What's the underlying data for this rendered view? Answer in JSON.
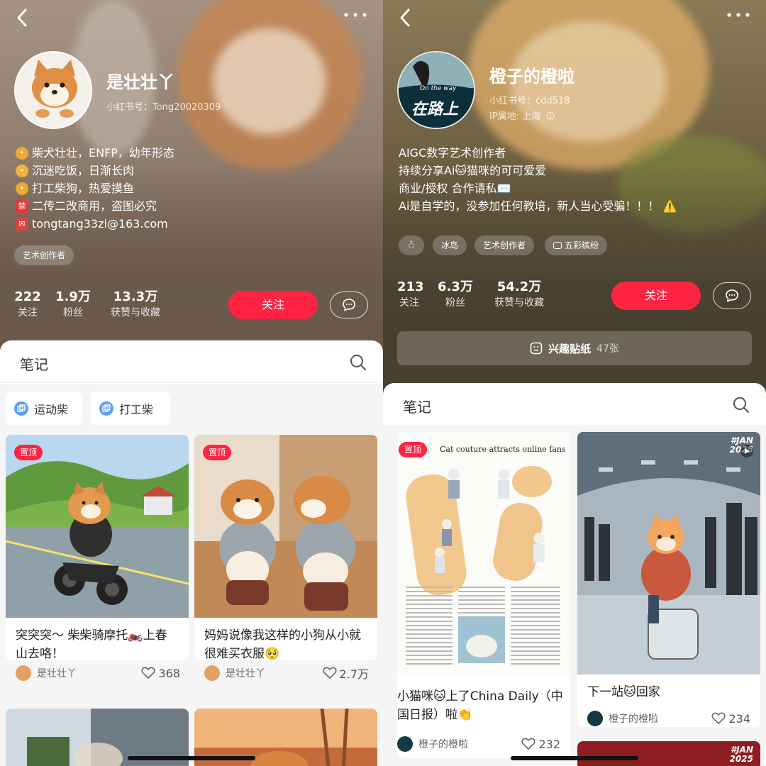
{
  "colors": {
    "accent": "#ff2442",
    "sheet": "#ffffff",
    "muted": "#666666"
  },
  "icons": {
    "back": "chevron-left-icon",
    "more": "more-dots-icon",
    "search": "search-icon",
    "message": "chat-bubble-icon",
    "like": "heart-outline-icon"
  },
  "left": {
    "nav": {
      "back": "‹",
      "more": "···"
    },
    "profile": {
      "name": "是壮壮丫",
      "id_label": "小红书号：Tong20020309",
      "bio": [
        {
          "emoji_color": "#f0a830",
          "text": "柴犬壮壮，ENFP，幼年形态"
        },
        {
          "emoji_color": "#f2b23b",
          "text": "沉迷吃饭，日渐长肉"
        },
        {
          "emoji_color": "#f0a830",
          "text": "打工柴狗，热爱摸鱼"
        },
        {
          "emoji_color": "#e53935",
          "emoji_char": "禁",
          "text": "二传二改商用，盗图必究"
        },
        {
          "emoji_color": "#d84343",
          "text": "tongtang33zi@163.com"
        }
      ],
      "tags": [
        "艺术创作者"
      ]
    },
    "stats": [
      {
        "num": "222",
        "label": "关注"
      },
      {
        "num": "1.9万",
        "label": "粉丝"
      },
      {
        "num": "13.3万",
        "label": "获赞与收藏"
      }
    ],
    "follow_label": "关注",
    "notes_label": "笔记",
    "collections": [
      "运动柴",
      "打工柴"
    ],
    "cards": [
      {
        "pinned": "置顶",
        "title": "突突突～ 柴柴骑摩托🏍️上春山去咯！",
        "author": "是壮壮丫",
        "likes": "368"
      },
      {
        "pinned": "置顶",
        "title": "妈妈说像我这样的小狗从小就很难买衣服🥺",
        "author": "是壮壮丫",
        "likes": "2.7万"
      }
    ]
  },
  "right": {
    "nav": {
      "back": "‹",
      "more": "···"
    },
    "profile": {
      "name": "橙子的橙啦",
      "avatar_text_top": "On the way",
      "avatar_text_main": "在路上",
      "id_label": "小红书号：cdd518",
      "ip_label": "IP属地: 上海",
      "bio": [
        "AIGC数字艺术创作者",
        "持续分享Ai🐱猫咪的可可爱爱",
        "商业/授权 合作请私✉️",
        "Ai是自学的，没参加任何教培，新人当心受骗！！！ ⚠️"
      ],
      "tags": [
        "♁",
        "冰岛",
        "艺术创作者",
        "五彩缤纷"
      ]
    },
    "stats": [
      {
        "num": "213",
        "label": "关注"
      },
      {
        "num": "6.3万",
        "label": "粉丝"
      },
      {
        "num": "54.2万",
        "label": "获赞与收藏"
      }
    ],
    "follow_label": "关注",
    "sticker": {
      "label": "兴趣贴纸",
      "count": "47张"
    },
    "notes_label": "笔记",
    "cards": [
      {
        "pinned": "置顶",
        "newspaper_header": "Cat couture attracts online fans",
        "title": "小猫咪🐱上了China Daily（中国日报）啦👏",
        "author": "橙子的橙啦",
        "likes": "232"
      },
      {
        "badge": "#JAN 2025",
        "title": "下一站🐱回家",
        "author": "橙子的橙啦",
        "likes": "234"
      },
      {
        "badge": "#JAN 2025"
      }
    ]
  }
}
